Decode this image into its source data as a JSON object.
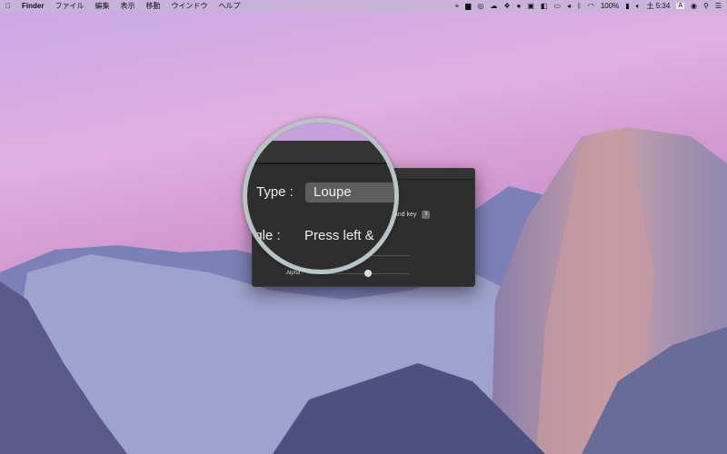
{
  "menubar": {
    "app": "Finder",
    "items": [
      "ファイル",
      "編集",
      "表示",
      "移動",
      "ウインドウ",
      "ヘルプ"
    ],
    "battery": "100%",
    "clock": "土 5:34",
    "input_method": "A"
  },
  "panel": {
    "type_label": "Type :",
    "type_value": "Loupe",
    "toggle_label": "ggle :",
    "toggle_value": "Press left & ",
    "modifier_value": "mand key",
    "alpha_label": "Alpha :",
    "alpha_value": 0.6
  }
}
